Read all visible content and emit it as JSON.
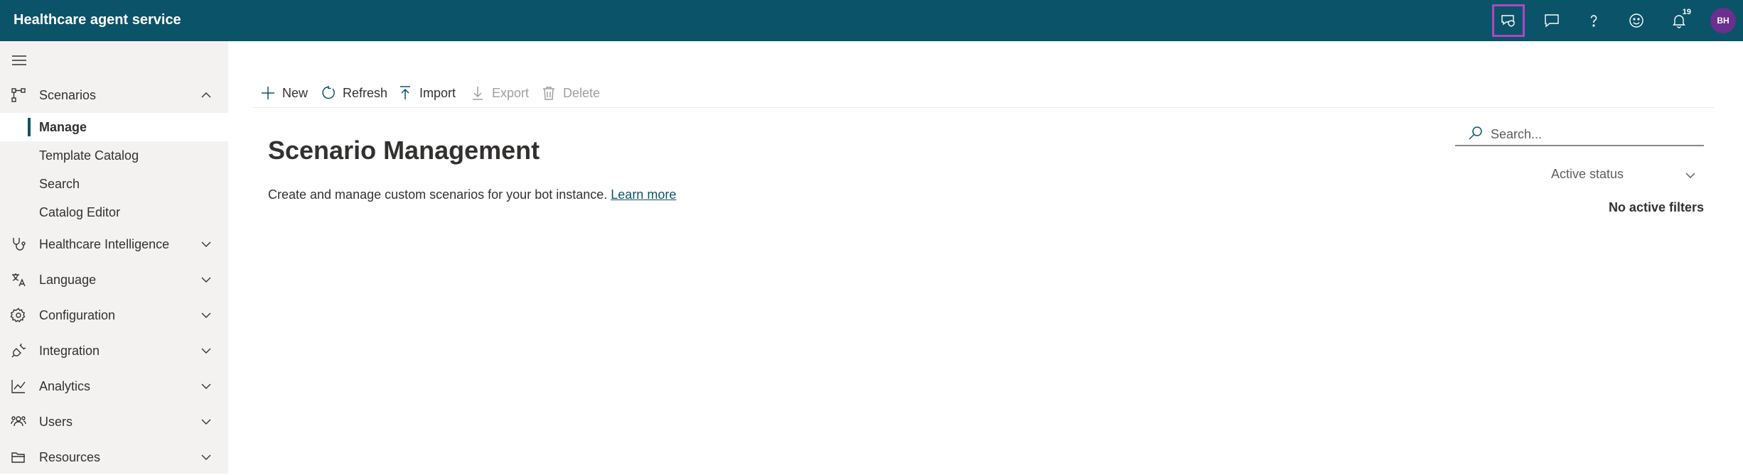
{
  "header": {
    "app_title": "Healthcare agent service",
    "notification_count": "19",
    "avatar_initials": "BH",
    "icons": [
      "feedback-shield-icon",
      "chat-icon",
      "help-icon",
      "smiley-icon",
      "bell-icon"
    ],
    "bg_color": "#0b5369",
    "highlight_color": "#b146c2"
  },
  "sidebar": {
    "items": [
      {
        "label": "Scenarios",
        "icon": "flow-icon",
        "expanded": true
      },
      {
        "label": "Healthcare Intelligence",
        "icon": "stethoscope-icon",
        "expanded": false
      },
      {
        "label": "Language",
        "icon": "language-icon",
        "expanded": false
      },
      {
        "label": "Configuration",
        "icon": "gear-icon",
        "expanded": false
      },
      {
        "label": "Integration",
        "icon": "plug-icon",
        "expanded": false
      },
      {
        "label": "Analytics",
        "icon": "chart-icon",
        "expanded": false
      },
      {
        "label": "Users",
        "icon": "users-icon",
        "expanded": false
      },
      {
        "label": "Resources",
        "icon": "folder-icon",
        "expanded": false
      }
    ],
    "sub_items": [
      {
        "label": "Manage",
        "active": true
      },
      {
        "label": "Template Catalog",
        "active": false
      },
      {
        "label": "Search",
        "active": false
      },
      {
        "label": "Catalog Editor",
        "active": false
      }
    ]
  },
  "toolbar": {
    "new_label": "New",
    "refresh_label": "Refresh",
    "import_label": "Import",
    "export_label": "Export",
    "delete_label": "Delete"
  },
  "main": {
    "title": "Scenario Management",
    "description": "Create and manage custom scenarios for your bot instance.",
    "learn_more": "Learn more",
    "search_placeholder": "Search...",
    "status_filter": "Active status",
    "no_filters": "No active filters"
  }
}
